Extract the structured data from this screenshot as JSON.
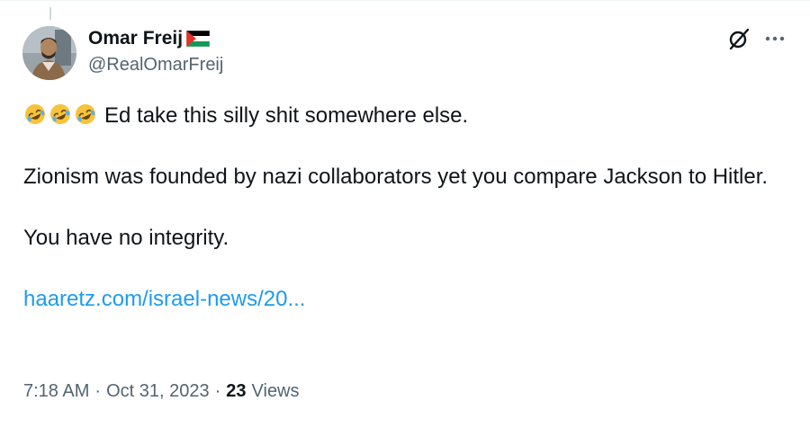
{
  "author": {
    "display_name": "Omar Freij",
    "flag_icon": "palestine-flag-icon",
    "handle": "@RealOmarFreij",
    "avatar_icon": "user-avatar"
  },
  "actions": {
    "grok_icon": "grok-slash-icon",
    "more_icon": "more-options-icon"
  },
  "tweet": {
    "emoji": [
      "rolling-on-floor-laughing",
      "rolling-on-floor-laughing",
      "rolling-on-floor-laughing"
    ],
    "line1": "Ed take this silly shit somewhere else.",
    "line2": "Zionism was founded by nazi collaborators yet you compare Jackson to Hitler.",
    "line3": "You have no integrity.",
    "link_text": "haaretz.com/israel-news/20..."
  },
  "meta": {
    "time": "7:18 AM",
    "separator": "·",
    "date": "Oct 31, 2023",
    "views_count": "23",
    "views_label": "Views"
  },
  "colors": {
    "link": "#1d9bf0",
    "secondary_text": "#536471",
    "primary_text": "#0f1419"
  }
}
